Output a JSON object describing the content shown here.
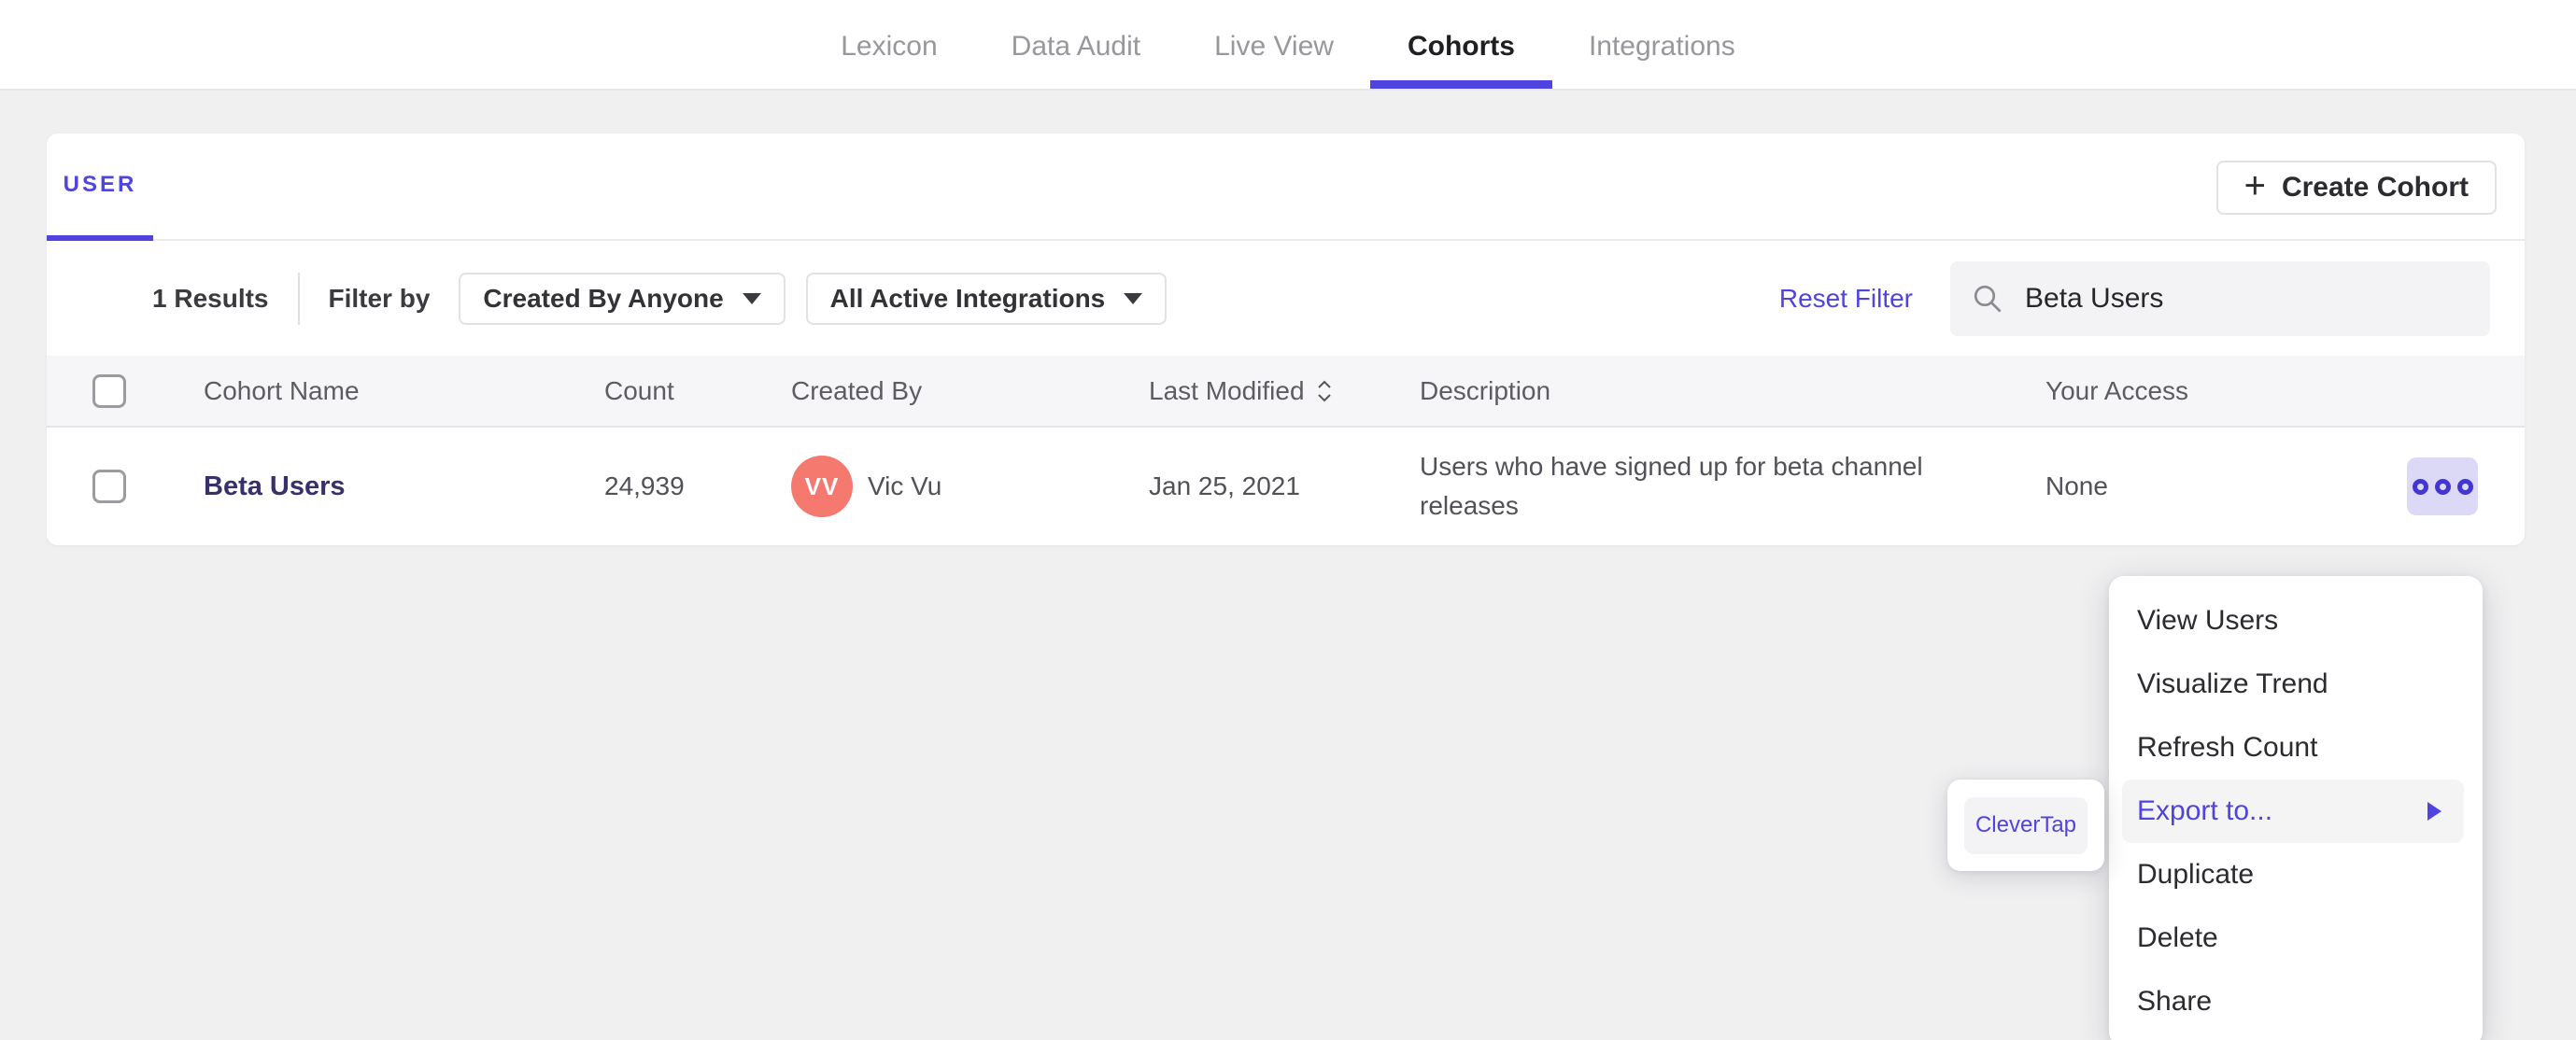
{
  "nav": {
    "active_tab": "Cohorts",
    "tabs": [
      {
        "label": "Lexicon"
      },
      {
        "label": "Data Audit"
      },
      {
        "label": "Live View"
      },
      {
        "label": "Cohorts"
      },
      {
        "label": "Integrations"
      }
    ]
  },
  "panel": {
    "user_tab_label": "USER",
    "create_cohort_label": "Create Cohort",
    "plus_icon": "+",
    "filter": {
      "results": "1 Results",
      "filter_by": "Filter by",
      "created_by_dropdown": "Created By Anyone",
      "integrations_dropdown": "All Active Integrations",
      "reset_label": "Reset Filter",
      "search_value": "Beta Users"
    },
    "table": {
      "headers": [
        "Cohort Name",
        "Count",
        "Created By",
        "Last Modified",
        "Description",
        "Your Access"
      ],
      "row": {
        "name": "Beta Users",
        "count": "24,939",
        "avatar_initials": "VV",
        "created_by": "Vic Vu",
        "last_modified": "Jan 25, 2021",
        "description": "Users who have signed up for beta channel releases",
        "access": "None"
      }
    }
  },
  "context_menu": {
    "items": [
      {
        "label": "View Users"
      },
      {
        "label": "Visualize Trend"
      },
      {
        "label": "Refresh Count"
      },
      {
        "label": "Export to...",
        "highlighted": true,
        "has_submenu": true
      },
      {
        "label": "Duplicate"
      },
      {
        "label": "Delete"
      },
      {
        "label": "Share"
      }
    ]
  },
  "export_submenu": {
    "items": [
      {
        "label": "CleverTap"
      }
    ]
  },
  "colors": {
    "accent_purple": "#4f44e0",
    "avatar_coral": "#f5796f",
    "link_indigo": "#37306b",
    "actions_button_bg": "#dbd9f5"
  }
}
